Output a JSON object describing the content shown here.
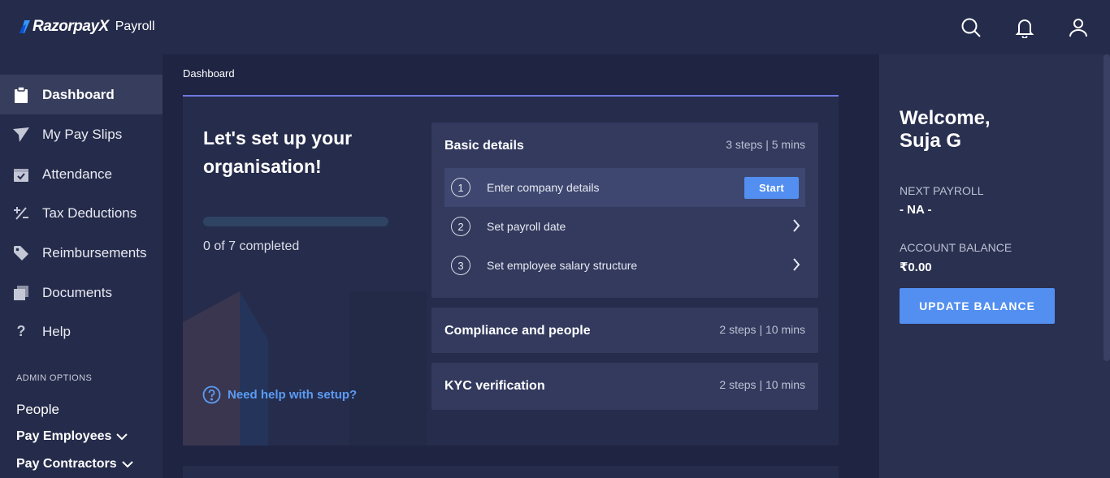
{
  "header": {
    "brand_name": "RazorpayX",
    "product_name": "Payroll",
    "icons": [
      "search-icon",
      "bell-icon",
      "user-icon"
    ]
  },
  "sidebar": {
    "items": [
      {
        "label": "Dashboard",
        "icon": "clipboard-icon",
        "active": true
      },
      {
        "label": "My Pay Slips",
        "icon": "paper-plane-icon",
        "active": false
      },
      {
        "label": "Attendance",
        "icon": "calendar-check-icon",
        "active": false
      },
      {
        "label": "Tax Deductions",
        "icon": "plus-minus-icon",
        "active": false
      },
      {
        "label": "Reimbursements",
        "icon": "tag-icon",
        "active": false
      },
      {
        "label": "Documents",
        "icon": "documents-icon",
        "active": false
      },
      {
        "label": "Help",
        "icon": "question-icon",
        "active": false
      }
    ],
    "admin_label": "ADMIN OPTIONS",
    "admin_items": [
      {
        "label": "People"
      },
      {
        "label": "Pay Employees"
      },
      {
        "label": "Pay Contractors"
      }
    ]
  },
  "main": {
    "breadcrumb": "Dashboard",
    "setup": {
      "title": "Let's set up your organisation!",
      "progress_completed": 0,
      "progress_total": 7,
      "progress_text": "0 of 7 completed",
      "help_link": "Need help with setup?"
    },
    "cards": [
      {
        "title": "Basic details",
        "meta": "3 steps | 5 mins",
        "steps": [
          {
            "num": "1",
            "label": "Enter company details",
            "action": "Start"
          },
          {
            "num": "2",
            "label": "Set payroll date"
          },
          {
            "num": "3",
            "label": "Set employee salary structure"
          }
        ]
      },
      {
        "title": "Compliance and people",
        "meta": "2 steps | 10 mins"
      },
      {
        "title": "KYC verification",
        "meta": "2 steps | 10 mins"
      }
    ]
  },
  "right_panel": {
    "welcome_line1": "Welcome,",
    "welcome_line2": "Suja G",
    "next_payroll_label": "NEXT PAYROLL",
    "next_payroll_value": "- NA -",
    "account_balance_label": "ACCOUNT BALANCE",
    "account_balance_value": "₹0.00",
    "update_button": "UPDATE BALANCE"
  },
  "colors": {
    "background": "#252b4a",
    "main_background": "#1f2443",
    "accent": "#528ff0",
    "active_nav": "#373d5c",
    "progress_line": "#6f79e0"
  }
}
